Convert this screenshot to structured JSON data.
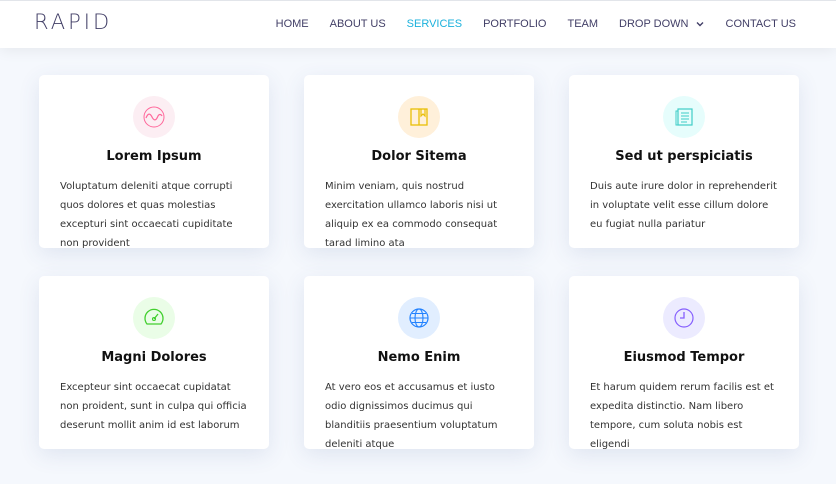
{
  "header": {
    "logo": "RAPID",
    "nav": [
      {
        "label": "HOME",
        "active": false
      },
      {
        "label": "ABOUT US",
        "active": false
      },
      {
        "label": "SERVICES",
        "active": true
      },
      {
        "label": "PORTFOLIO",
        "active": false
      },
      {
        "label": "TEAM",
        "active": false
      },
      {
        "label": "DROP DOWN",
        "active": false,
        "dropdown": true
      },
      {
        "label": "CONTACT US",
        "active": false
      }
    ]
  },
  "colors": {
    "nav_text": "#413e66",
    "nav_active": "#1bb1dc",
    "page_bg": "#f5f8fd"
  },
  "services": [
    {
      "title": "Lorem Ipsum",
      "description": "Voluptatum deleniti atque corrupti quos dolores et quas molestias excepturi sint occaecati cupiditate non provident",
      "icon": "activity-icon",
      "icon_color": "#ff689b",
      "icon_bg": "#fceef3"
    },
    {
      "title": "Dolor Sitema",
      "description": "Minim veniam, quis nostrud exercitation ullamco laboris nisi ut aliquip ex ea commodo consequat tarad limino ata",
      "icon": "bookmark-icon",
      "icon_color": "#e9bf06",
      "icon_bg": "#fff0da"
    },
    {
      "title": "Sed ut perspiciatis",
      "description": "Duis aute irure dolor in reprehenderit in voluptate velit esse cillum dolore eu fugiat nulla pariatur",
      "icon": "paper-icon",
      "icon_color": "#3fcdc7",
      "icon_bg": "#e6fdfc"
    },
    {
      "title": "Magni Dolores",
      "description": "Excepteur sint occaecat cupidatat non proident, sunt in culpa qui officia deserunt mollit anim id est laborum",
      "icon": "speedometer-icon",
      "icon_color": "#41cf2e",
      "icon_bg": "#eafde7"
    },
    {
      "title": "Nemo Enim",
      "description": "At vero eos et accusamus et iusto odio dignissimos ducimus qui blanditiis praesentium voluptatum deleniti atque",
      "icon": "globe-icon",
      "icon_color": "#2282ff",
      "icon_bg": "#e1eeff"
    },
    {
      "title": "Eiusmod Tempor",
      "description": "Et harum quidem rerum facilis est et expedita distinctio. Nam libero tempore, cum soluta nobis est eligendi",
      "icon": "clock-icon",
      "icon_color": "#8660fe",
      "icon_bg": "#ecebff"
    }
  ]
}
